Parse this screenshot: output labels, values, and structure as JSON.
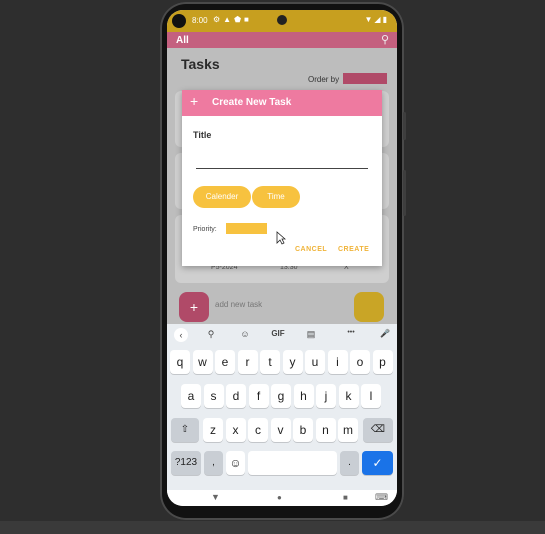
{
  "status_bar": {
    "time": "8:00",
    "left_icons": "⚙▲⬟■",
    "right_icons": "▼◢▮"
  },
  "app": {
    "tab_label": "All",
    "page_title": "Tasks",
    "order_by_label": "Order by",
    "bg_card": {
      "date": "P5-2024",
      "time": "13:30",
      "x": "X"
    },
    "add_new_label": "add new task"
  },
  "dialog": {
    "plus": "+",
    "title": "Create New Task",
    "field_label": "Title",
    "title_value": "",
    "calendar_label": "Calender",
    "time_label": "Time",
    "priority_label": "Priority:",
    "cancel_label": "CANCEL",
    "create_label": "CREATE"
  },
  "keyboard": {
    "toolbar": {
      "back": "‹",
      "search": "⚲",
      "sticker": "☺",
      "gif": "GIF",
      "clipboard": "▤",
      "more": "•••",
      "mic": "🎤"
    },
    "row1": [
      "q",
      "w",
      "e",
      "r",
      "t",
      "y",
      "u",
      "i",
      "o",
      "p"
    ],
    "row1_hints": [
      "1",
      "2",
      "3",
      "4",
      "5",
      "6",
      "7",
      "8",
      "9",
      "0"
    ],
    "row2": [
      "a",
      "s",
      "d",
      "f",
      "g",
      "h",
      "j",
      "k",
      "l"
    ],
    "row3": [
      "z",
      "x",
      "c",
      "v",
      "b",
      "n",
      "m"
    ],
    "shift": "⇧",
    "backspace": "⌫",
    "sym": "?123",
    "comma": ",",
    "emoji": "☺",
    "period": ".",
    "enter": "✓"
  },
  "nav": {
    "back": "▼",
    "home": "●",
    "recents": "■",
    "keyboard": "⌨"
  },
  "colors": {
    "accent_pink": "#ee7aa0",
    "accent_yellow": "#f7c23f",
    "status_bar": "#c79f1f",
    "enter_blue": "#1a73e8"
  }
}
